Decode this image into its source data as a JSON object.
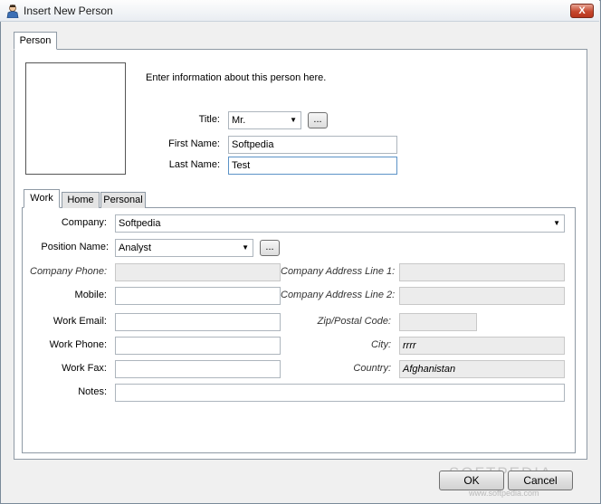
{
  "window": {
    "title": "Insert New Person",
    "close_label": "X"
  },
  "outer_tabs": [
    {
      "label": "Person"
    }
  ],
  "intro_text": "Enter information about this person here.",
  "person": {
    "title_label": "Title:",
    "title_value": "Mr.",
    "first_name_label": "First Name:",
    "first_name_value": "Softpedia",
    "last_name_label": "Last Name:",
    "last_name_value": "Test",
    "ellipsis": "..."
  },
  "inner_tabs": [
    {
      "label": "Work"
    },
    {
      "label": "Home"
    },
    {
      "label": "Personal"
    }
  ],
  "work": {
    "company_label": "Company:",
    "company_value": "Softpedia",
    "position_label": "Position Name:",
    "position_value": "Analyst",
    "company_phone_label": "Company Phone:",
    "company_phone_value": "",
    "mobile_label": "Mobile:",
    "mobile_value": "",
    "work_email_label": "Work Email:",
    "work_email_value": "",
    "work_phone_label": "Work Phone:",
    "work_phone_value": "",
    "work_fax_label": "Work Fax:",
    "work_fax_value": "",
    "notes_label": "Notes:",
    "notes_value": "",
    "addr1_label": "Company Address Line 1:",
    "addr1_value": "",
    "addr2_label": "Company Address Line 2:",
    "addr2_value": "",
    "zip_label": "Zip/Postal Code:",
    "zip_value": "",
    "city_label": "City:",
    "city_value": "rrrr",
    "country_label": "Country:",
    "country_value": "Afghanistan",
    "ellipsis": "..."
  },
  "buttons": {
    "ok": "OK",
    "cancel": "Cancel"
  },
  "watermark": {
    "main": "SOFTPEDIA",
    "sub": "www.softpedia.com"
  }
}
